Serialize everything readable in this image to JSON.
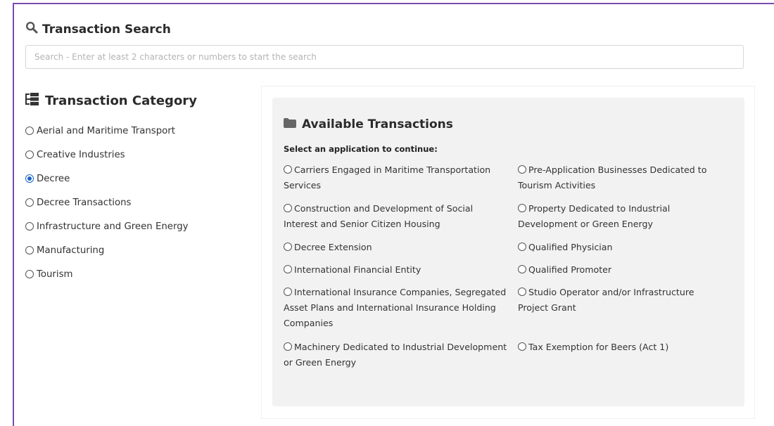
{
  "search": {
    "title": "Transaction Search",
    "placeholder": "Search - Enter at least 2 characters or numbers to start the search",
    "value": ""
  },
  "category": {
    "title": "Transaction Category",
    "items": [
      {
        "label": "Aerial and Maritime Transport",
        "selected": false
      },
      {
        "label": "Creative Industries",
        "selected": false
      },
      {
        "label": "Decree",
        "selected": true
      },
      {
        "label": "Decree Transactions",
        "selected": false
      },
      {
        "label": "Infrastructure and Green Energy",
        "selected": false
      },
      {
        "label": "Manufacturing",
        "selected": false
      },
      {
        "label": "Tourism",
        "selected": false
      }
    ]
  },
  "transactions": {
    "title": "Available Transactions",
    "instruction": "Select an application to continue:",
    "items": [
      {
        "label": "Carriers Engaged in Maritime Transportation Services"
      },
      {
        "label": "Pre-Application Businesses Dedicated to Tourism Activities"
      },
      {
        "label": "Construction and Development of Social Interest and Senior Citizen Housing"
      },
      {
        "label": "Property Dedicated to Industrial Development or Green Energy"
      },
      {
        "label": "Decree Extension"
      },
      {
        "label": "Qualified Physician"
      },
      {
        "label": "International Financial Entity"
      },
      {
        "label": "Qualified Promoter"
      },
      {
        "label": "International Insurance Companies, Segregated Asset Plans and International Insurance Holding Companies"
      },
      {
        "label": "Studio Operator and/or Infrastructure Project Grant"
      },
      {
        "label": "Machinery Dedicated to Industrial Development or Green Energy"
      },
      {
        "label": "Tax Exemption for Beers (Act 1)"
      }
    ]
  },
  "colors": {
    "frame_border": "#7b4bb0",
    "radio_selected": "#1a63c9",
    "panel_background": "#f2f2f2"
  },
  "icons": {
    "search": "search-icon",
    "category": "sitemap-icon",
    "transactions": "folder-icon"
  }
}
